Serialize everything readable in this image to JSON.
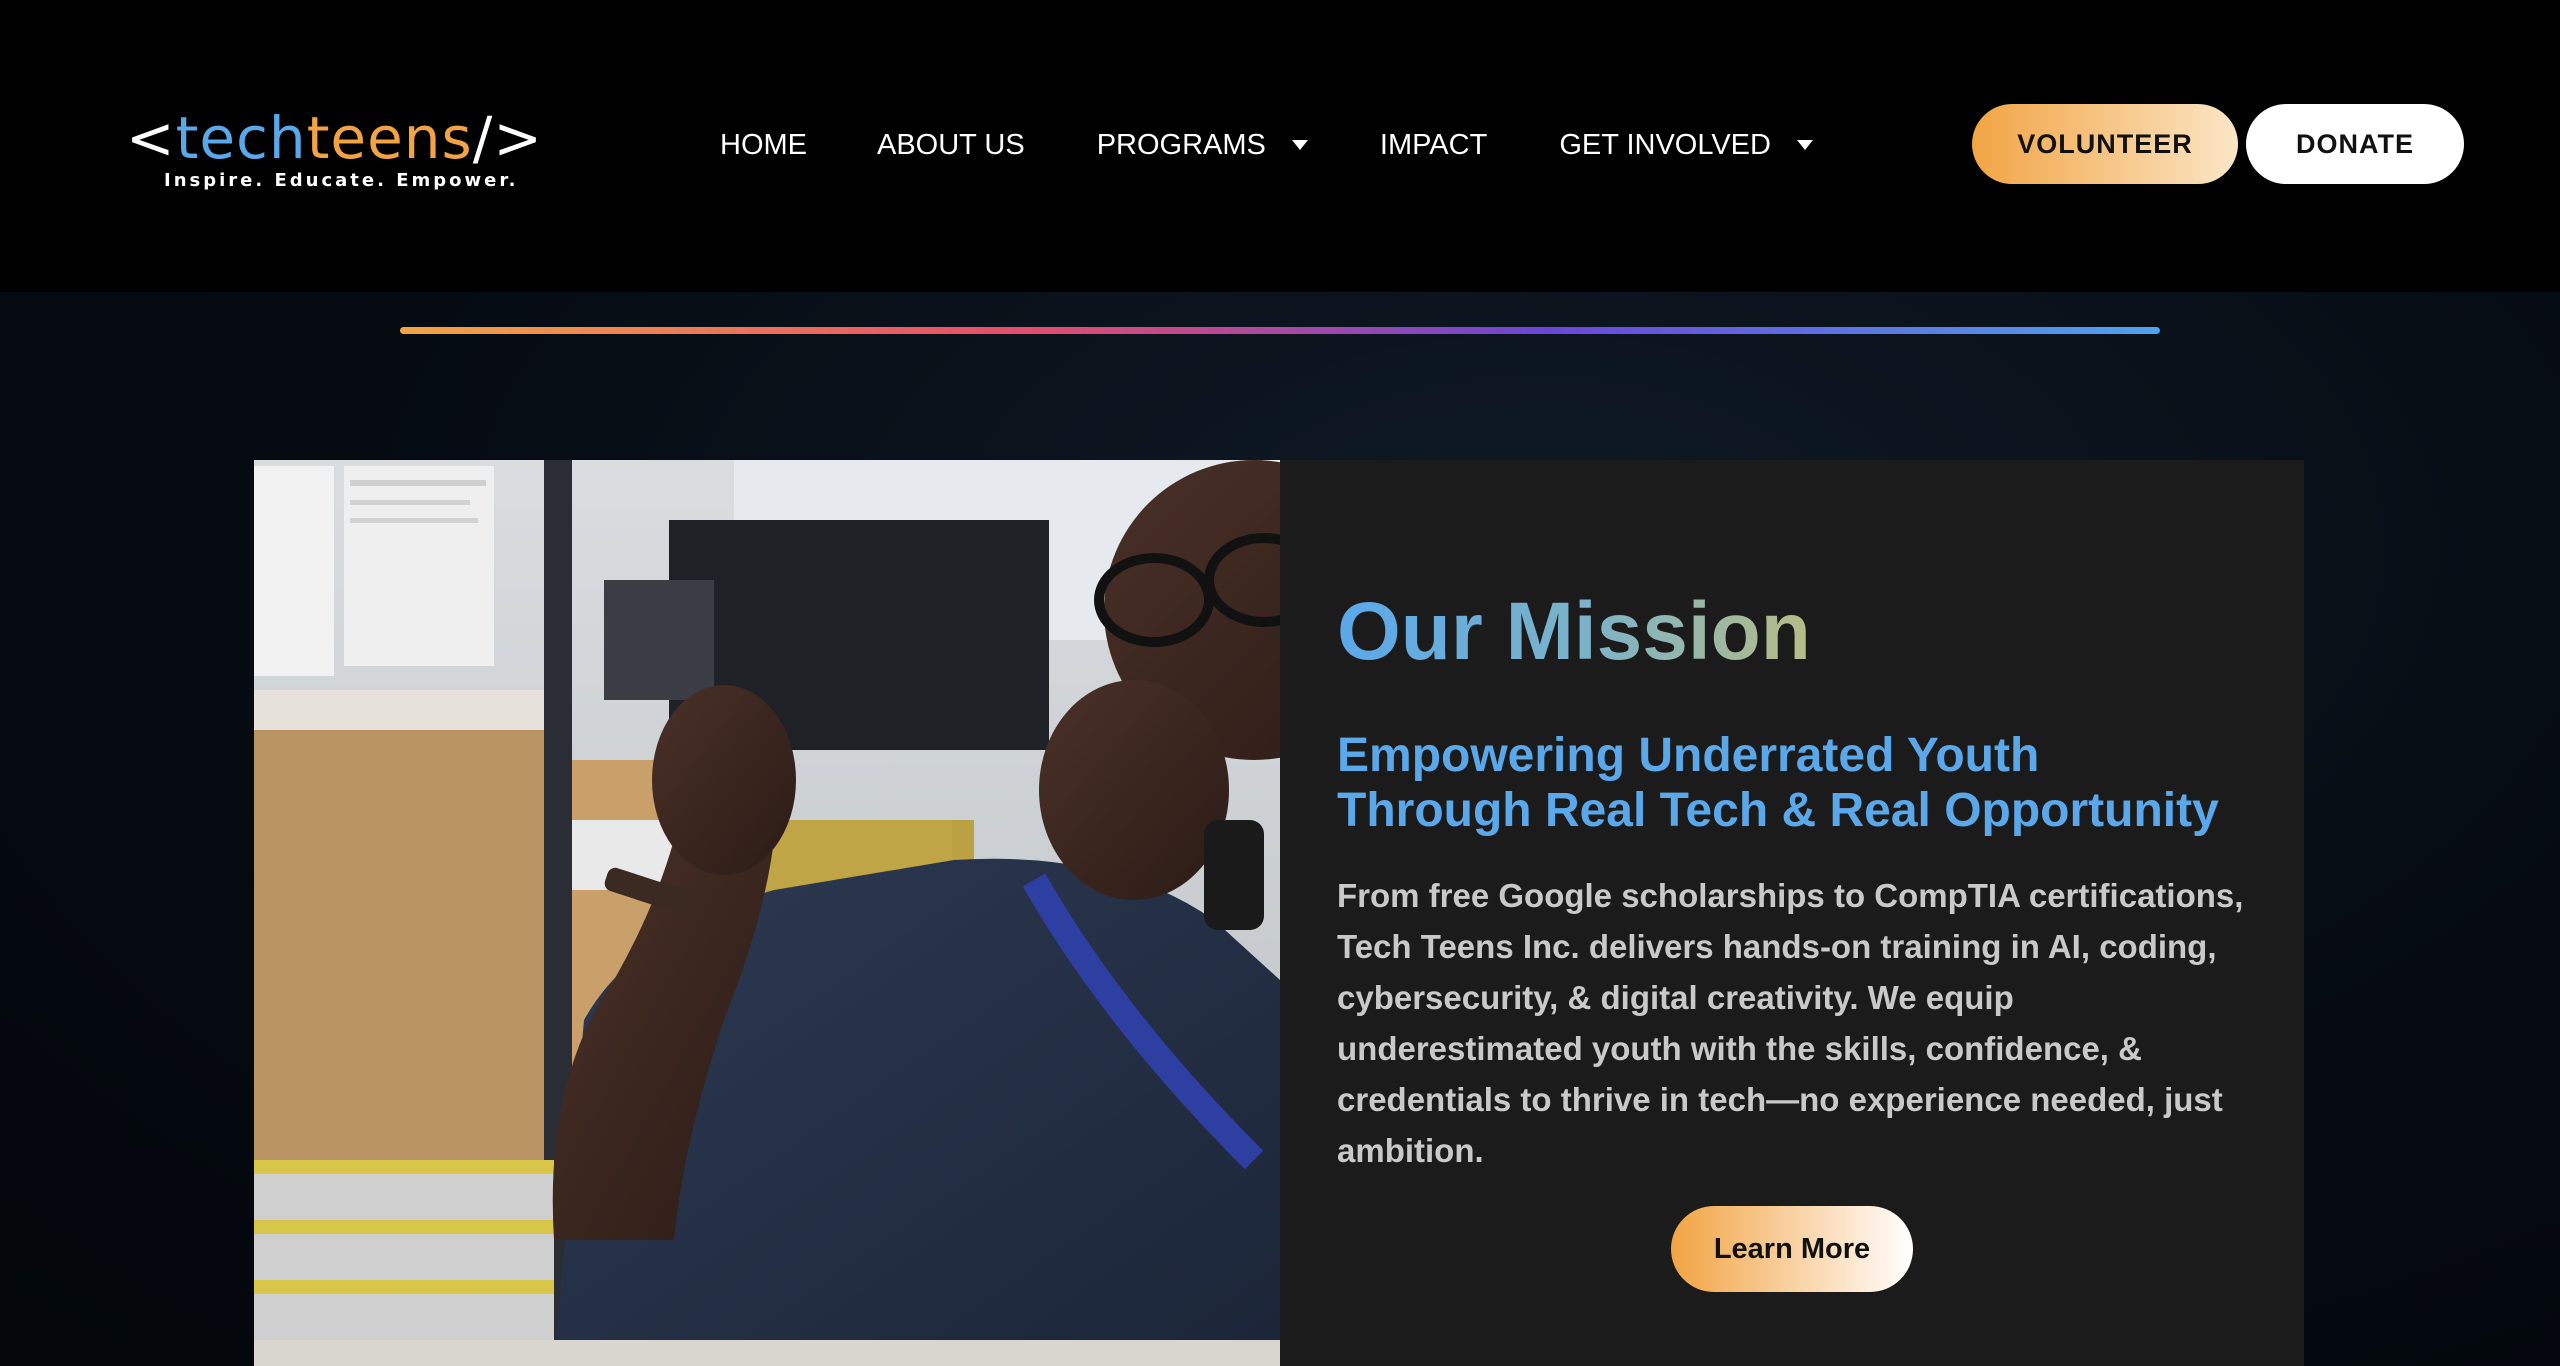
{
  "header": {
    "logo": {
      "open_bracket": "<",
      "word_tech": "tech",
      "word_teens": "teens",
      "close_bracket": "/>",
      "tagline": "Inspire. Educate. Empower."
    },
    "nav": [
      {
        "label": "HOME",
        "has_dropdown": false
      },
      {
        "label": "ABOUT US",
        "has_dropdown": false
      },
      {
        "label": "PROGRAMS",
        "has_dropdown": true
      },
      {
        "label": "IMPACT",
        "has_dropdown": false
      },
      {
        "label": "GET INVOLVED",
        "has_dropdown": true
      }
    ],
    "volunteer_label": "VOLUNTEER",
    "donate_label": "DONATE"
  },
  "mission": {
    "title": "Our Mission",
    "subtitle": "Empowering Underrated Youth Through Real Tech & Real Opportunity",
    "body": "From free Google scholarships to CompTIA certifications, Tech Teens Inc. delivers hands-on training in AI, coding, cybersecurity, & digital creativity. We equip underestimated youth with the skills, confidence, & credentials to thrive in tech—no experience needed, just ambition.",
    "cta_label": "Learn More"
  },
  "colors": {
    "brand_blue": "#5aa8ea",
    "brand_orange": "#f2a444",
    "header_bg": "#000000",
    "card_bg": "#1b1b1b",
    "page_bg": "#060b12"
  },
  "icons": [
    "caret-down-icon"
  ]
}
